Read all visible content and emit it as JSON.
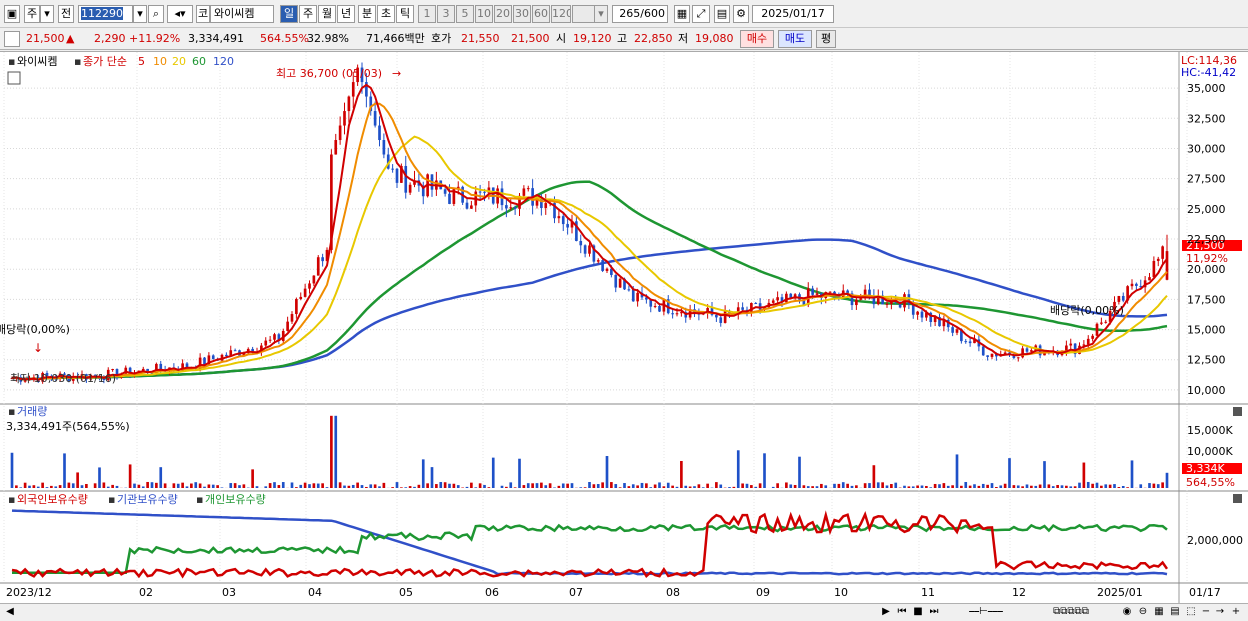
{
  "toolbar": {
    "market": "주",
    "scope": "전",
    "code": "112290",
    "corp_badge": "코",
    "name": "와이씨켐",
    "periods": [
      "일",
      "주",
      "월",
      "년",
      "분",
      "초",
      "틱"
    ],
    "intervals": [
      "1",
      "3",
      "5",
      "10",
      "20",
      "30",
      "60",
      "120"
    ],
    "count": "265",
    "count_total": "/600",
    "date": "2025/01/17"
  },
  "info": {
    "price": "21,500",
    "change_arrow": "▲",
    "change": "2,290",
    "change_pct": "+11.92%",
    "volume": "3,334,491",
    "vol_ratio": "564.55%",
    "turnover": "32.98%",
    "amount": "71,466백만",
    "quote_label": "호가",
    "ask": "21,550",
    "bid": "21,500",
    "open_label": "시",
    "open": "19,120",
    "high_label": "고",
    "high": "22,850",
    "low_label": "저",
    "low": "19,080",
    "buy": "매수",
    "sell": "매도",
    "avg": "평"
  },
  "price_panel": {
    "name": "와이씨켐",
    "ma_label": "종가 단순",
    "ma_periods": [
      "5",
      "10",
      "20",
      "60",
      "120"
    ],
    "ma_colors": [
      "#d00000",
      "#f08c00",
      "#e8c800",
      "#1e9632",
      "#3050c8"
    ],
    "max_note": "최고 36,700 (05/03)",
    "min_note": "최저 10,030 (01/16)",
    "div_note1": "배당락(0,00%)",
    "div_note2": "배당락(0,00%)",
    "lc": "LC:114,36",
    "hc": "HC:-41,42",
    "y_ticks": [
      "35,000",
      "32,500",
      "30,000",
      "27,500",
      "25,000",
      "22,500",
      "20,000",
      "17,500",
      "15,000",
      "12,500",
      "10,000"
    ],
    "last_price": "21,500",
    "last_pct": "11,92%"
  },
  "volume_panel": {
    "title": "거래량",
    "value": "3,334,491주(564,55%)",
    "ticks": [
      "15,000K",
      "10,000K",
      "5,000K"
    ],
    "last": "3,334K",
    "last_pct": "564,55%"
  },
  "holding_panel": {
    "labels": [
      "외국인보유수량",
      "기관보유수량",
      "개인보유수량"
    ],
    "colors": [
      "#d00000",
      "#3050c8",
      "#1e9632"
    ],
    "tick": "2,000,000"
  },
  "x_axis": {
    "labels": [
      "2023/12",
      "02",
      "03",
      "04",
      "05",
      "06",
      "07",
      "08",
      "09",
      "10",
      "11",
      "12",
      "2025/01",
      "01/17"
    ]
  },
  "chart_data": {
    "type": "candlestick",
    "title": "와이씨켐",
    "start": "2023/12",
    "end": "2025/01/17",
    "bars": 265,
    "ylim": [
      9000,
      36500
    ],
    "monthly_close": [
      {
        "month": "2023/12",
        "close": 11000
      },
      {
        "month": "2024/01",
        "close": 11200
      },
      {
        "month": "2024/02",
        "close": 12000
      },
      {
        "month": "2024/03",
        "close": 14200
      },
      {
        "month": "2024/04",
        "close": 28500
      },
      {
        "month": "2024/05",
        "close": 26000
      },
      {
        "month": "2024/06",
        "close": 26000
      },
      {
        "month": "2024/07",
        "close": 17500
      },
      {
        "month": "2024/08",
        "close": 16000
      },
      {
        "month": "2024/09",
        "close": 17800
      },
      {
        "month": "2024/10",
        "close": 17500
      },
      {
        "month": "2024/11",
        "close": 13000
      },
      {
        "month": "2024/12",
        "close": 13500
      },
      {
        "month": "2025/01/17",
        "close": 21500
      }
    ],
    "high": {
      "value": 36700,
      "date": "05/03"
    },
    "low": {
      "value": 10030,
      "date": "01/16"
    },
    "last": {
      "close": 21500,
      "open": 19120,
      "high": 22850,
      "low": 19080,
      "volume": 3334491
    }
  }
}
